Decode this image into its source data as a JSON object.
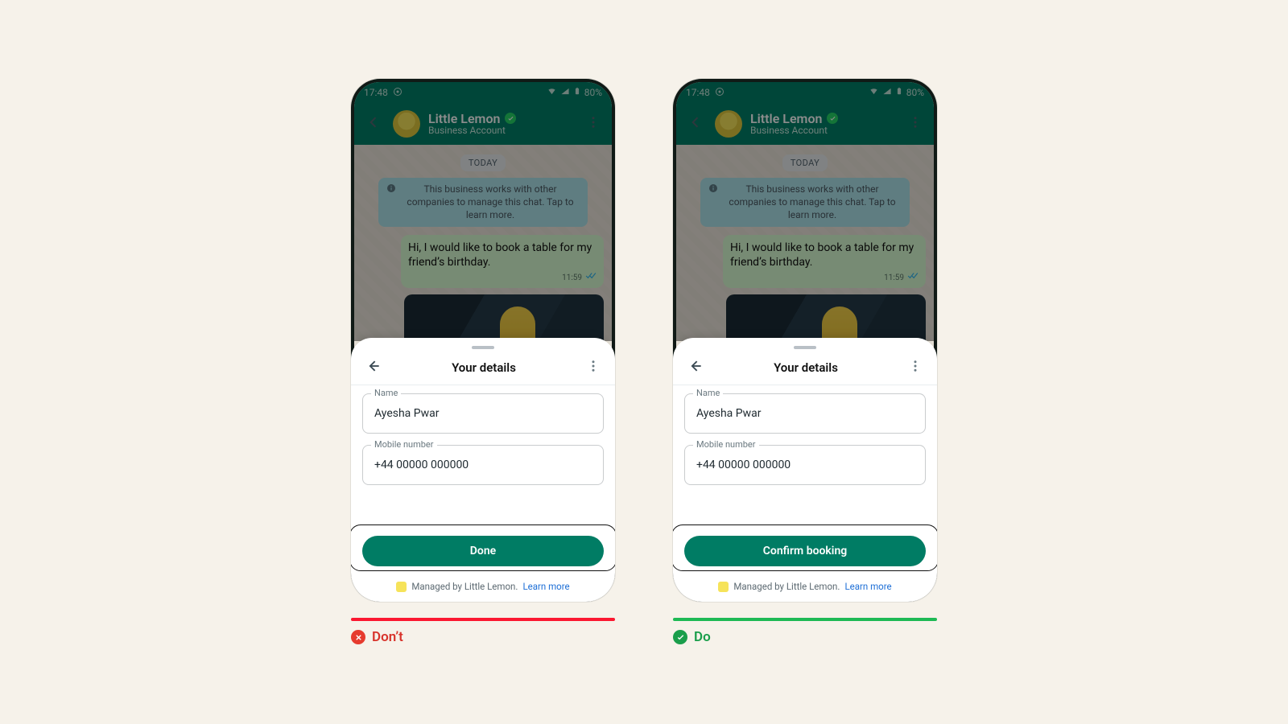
{
  "status": {
    "time": "17:48",
    "battery": "80%"
  },
  "header": {
    "name": "Little Lemon",
    "subtitle": "Business Account",
    "verified": true
  },
  "chat": {
    "day_label": "TODAY",
    "notice": "This business works with other companies to manage this chat. Tap to learn more.",
    "message": {
      "text": "Hi, I would like to book a table for my friend’s birthday.",
      "time": "11:59"
    }
  },
  "sheet": {
    "title": "Your details",
    "name_label": "Name",
    "name_value": "Ayesha Pwar",
    "mobile_label": "Mobile number",
    "mobile_value": "+44 00000 000000",
    "managed_text": "Managed by Little Lemon.",
    "learn_more": "Learn more"
  },
  "examples": {
    "dont": {
      "cta": "Done",
      "marker": "Don’t"
    },
    "do": {
      "cta": "Confirm booking",
      "marker": "Do"
    }
  }
}
